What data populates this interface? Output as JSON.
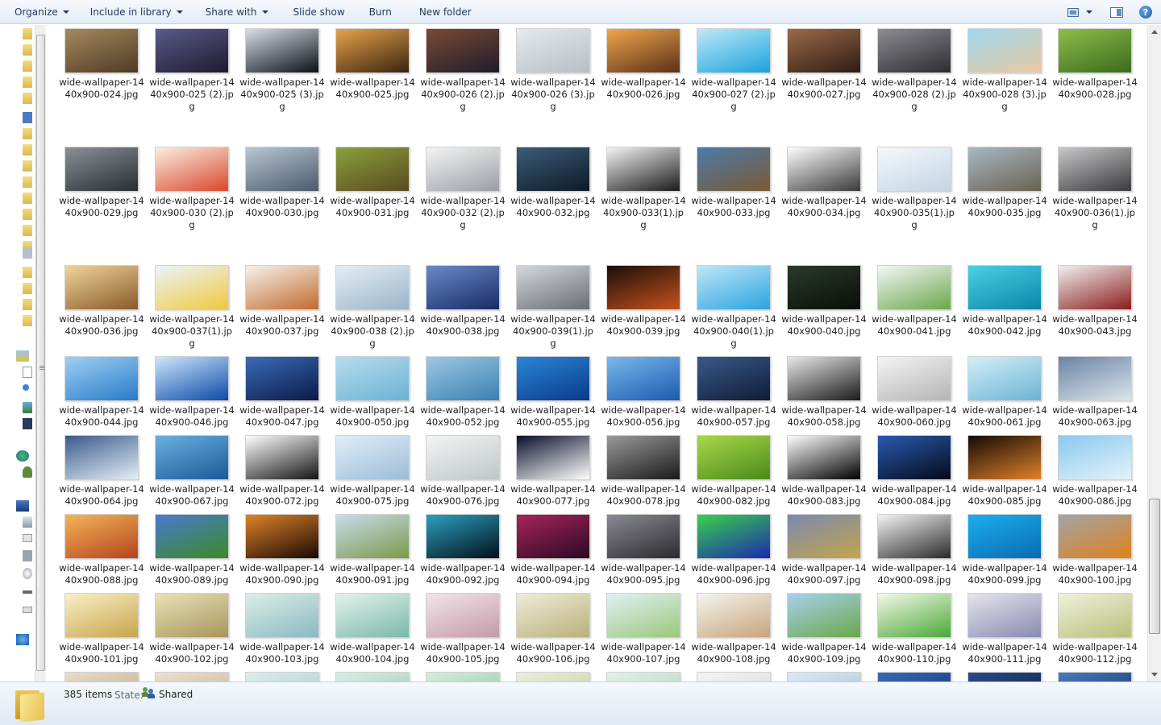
{
  "toolbar": {
    "organize": "Organize",
    "include_in_library": "Include in library",
    "share_with": "Share with",
    "slide_show": "Slide show",
    "burn": "Burn",
    "new_folder": "New folder",
    "help_glyph": "?"
  },
  "files": [
    {
      "name": "wide-wallpaper-1440x900-024.jpg",
      "colors": [
        "#a58a5e",
        "#4f3a24"
      ]
    },
    {
      "name": "wide-wallpaper-1440x900-025 (2).jpg",
      "colors": [
        "#5b5a8a",
        "#1e1a30"
      ]
    },
    {
      "name": "wide-wallpaper-1440x900-025 (3).jpg",
      "colors": [
        "#d9dde6",
        "#0b1018"
      ]
    },
    {
      "name": "wide-wallpaper-1440x900-025.jpg",
      "colors": [
        "#e8a24a",
        "#3a2410"
      ]
    },
    {
      "name": "wide-wallpaper-1440x900-026 (2).jpg",
      "colors": [
        "#7a4a34",
        "#1f1c2c"
      ]
    },
    {
      "name": "wide-wallpaper-1440x900-026 (3).jpg",
      "colors": [
        "#e6e9ec",
        "#b7bec6"
      ]
    },
    {
      "name": "wide-wallpaper-1440x900-026.jpg",
      "colors": [
        "#f0a64e",
        "#5a3016"
      ]
    },
    {
      "name": "wide-wallpaper-1440x900-027 (2).jpg",
      "colors": [
        "#bfe8f8",
        "#1aa3dc"
      ]
    },
    {
      "name": "wide-wallpaper-1440x900-027.jpg",
      "colors": [
        "#9c6a48",
        "#2e1c14"
      ]
    },
    {
      "name": "wide-wallpaper-1440x900-028 (2).jpg",
      "colors": [
        "#8c8c92",
        "#2c2c30"
      ]
    },
    {
      "name": "wide-wallpaper-1440x900-028 (3).jpg",
      "colors": [
        "#9fd8f0",
        "#e8c9a0"
      ]
    },
    {
      "name": "wide-wallpaper-1440x900-028.jpg",
      "colors": [
        "#8cbe4a",
        "#3c6a1c"
      ]
    },
    {
      "name": "wide-wallpaper-1440x900-029.jpg",
      "colors": [
        "#8a9096",
        "#2a2e34"
      ]
    },
    {
      "name": "wide-wallpaper-1440x900-030 (2).jpg",
      "colors": [
        "#fbeee2",
        "#d8482c"
      ]
    },
    {
      "name": "wide-wallpaper-1440x900-030.jpg",
      "colors": [
        "#b9c7d4",
        "#4a5a6c"
      ]
    },
    {
      "name": "wide-wallpaper-1440x900-031.jpg",
      "colors": [
        "#8aa03c",
        "#5a4a20"
      ]
    },
    {
      "name": "wide-wallpaper-1440x900-032 (2).jpg",
      "colors": [
        "#f4f4f4",
        "#9a9ea4"
      ]
    },
    {
      "name": "wide-wallpaper-1440x900-032.jpg",
      "colors": [
        "#3c5c78",
        "#0c1a28"
      ]
    },
    {
      "name": "wide-wallpaper-1440x900-033(1).jpg",
      "colors": [
        "#f4f4f4",
        "#1a1a1a"
      ]
    },
    {
      "name": "wide-wallpaper-1440x900-033.jpg",
      "colors": [
        "#4c7aa8",
        "#7a5a34"
      ]
    },
    {
      "name": "wide-wallpaper-1440x900-034.jpg",
      "colors": [
        "#ffffff",
        "#3a3a3a"
      ]
    },
    {
      "name": "wide-wallpaper-1440x900-035(1).jpg",
      "colors": [
        "#f4f8fc",
        "#c4d4e4"
      ]
    },
    {
      "name": "wide-wallpaper-1440x900-035.jpg",
      "colors": [
        "#a8b8c4",
        "#6a6250"
      ]
    },
    {
      "name": "wide-wallpaper-1440x900-036(1).jpg",
      "colors": [
        "#c8c8cc",
        "#3a3a3e"
      ]
    },
    {
      "name": "wide-wallpaper-1440x900-036.jpg",
      "colors": [
        "#efd49a",
        "#8a5a2a"
      ]
    },
    {
      "name": "wide-wallpaper-1440x900-037(1).jpg",
      "colors": [
        "#eaf4fc",
        "#f0c83c"
      ]
    },
    {
      "name": "wide-wallpaper-1440x900-037.jpg",
      "colors": [
        "#f4f2ee",
        "#c46a2c"
      ]
    },
    {
      "name": "wide-wallpaper-1440x900-038 (2).jpg",
      "colors": [
        "#e4eef6",
        "#9ab4c8"
      ]
    },
    {
      "name": "wide-wallpaper-1440x900-038.jpg",
      "colors": [
        "#6a8ac8",
        "#1a2a68"
      ]
    },
    {
      "name": "wide-wallpaper-1440x900-039(1).jpg",
      "colors": [
        "#d4d8dc",
        "#6a6e72"
      ]
    },
    {
      "name": "wide-wallpaper-1440x900-039.jpg",
      "colors": [
        "#1a0e0a",
        "#c8521c"
      ]
    },
    {
      "name": "wide-wallpaper-1440x900-040(1).jpg",
      "colors": [
        "#bfe6f8",
        "#2aa4e0"
      ]
    },
    {
      "name": "wide-wallpaper-1440x900-040.jpg",
      "colors": [
        "#2a3a2a",
        "#0a0e0a"
      ]
    },
    {
      "name": "wide-wallpaper-1440x900-041.jpg",
      "colors": [
        "#f4f6f8",
        "#6aa84a"
      ]
    },
    {
      "name": "wide-wallpaper-1440x900-042.jpg",
      "colors": [
        "#4ad0e4",
        "#0a86a8"
      ]
    },
    {
      "name": "wide-wallpaper-1440x900-043.jpg",
      "colors": [
        "#f0f0f0",
        "#8a1c1c"
      ]
    },
    {
      "name": "wide-wallpaper-1440x900-044.jpg",
      "colors": [
        "#9ed0f4",
        "#2a7ac8"
      ]
    },
    {
      "name": "wide-wallpaper-1440x900-046.jpg",
      "colors": [
        "#cfe6fa",
        "#0a4aa8"
      ]
    },
    {
      "name": "wide-wallpaper-1440x900-047.jpg",
      "colors": [
        "#3a6cb8",
        "#0a1a48"
      ]
    },
    {
      "name": "wide-wallpaper-1440x900-050.jpg",
      "colors": [
        "#b8dcef",
        "#6ab2d4"
      ]
    },
    {
      "name": "wide-wallpaper-1440x900-052.jpg",
      "colors": [
        "#9cc8e4",
        "#3a80b0"
      ]
    },
    {
      "name": "wide-wallpaper-1440x900-055.jpg",
      "colors": [
        "#2a86d8",
        "#0a3a88"
      ]
    },
    {
      "name": "wide-wallpaper-1440x900-056.jpg",
      "colors": [
        "#7ab8ec",
        "#1a5ab0"
      ]
    },
    {
      "name": "wide-wallpaper-1440x900-057.jpg",
      "colors": [
        "#3a5a88",
        "#0e1c38"
      ]
    },
    {
      "name": "wide-wallpaper-1440x900-058.jpg",
      "colors": [
        "#e8e8e8",
        "#1a1a1a"
      ]
    },
    {
      "name": "wide-wallpaper-1440x900-060.jpg",
      "colors": [
        "#f4f4f4",
        "#b4b4b4"
      ]
    },
    {
      "name": "wide-wallpaper-1440x900-061.jpg",
      "colors": [
        "#d4eef8",
        "#6ab4d4"
      ]
    },
    {
      "name": "wide-wallpaper-1440x900-063.jpg",
      "colors": [
        "#6a84a4",
        "#dce4ec"
      ]
    },
    {
      "name": "wide-wallpaper-1440x900-064.jpg",
      "colors": [
        "#3a5a8a",
        "#e4eef6"
      ]
    },
    {
      "name": "wide-wallpaper-1440x900-067.jpg",
      "colors": [
        "#6ab0e0",
        "#1a5a98"
      ]
    },
    {
      "name": "wide-wallpaper-1440x900-072.jpg",
      "colors": [
        "#ffffff",
        "#141414"
      ]
    },
    {
      "name": "wide-wallpaper-1440x900-075.jpg",
      "colors": [
        "#e0eef8",
        "#9cbcd8"
      ]
    },
    {
      "name": "wide-wallpaper-1440x900-076.jpg",
      "colors": [
        "#f2f4f4",
        "#c0c6c8"
      ]
    },
    {
      "name": "wide-wallpaper-1440x900-077.jpg",
      "colors": [
        "#0a0e2a",
        "#ffffff"
      ]
    },
    {
      "name": "wide-wallpaper-1440x900-078.jpg",
      "colors": [
        "#9a9a9a",
        "#1a1a1a"
      ]
    },
    {
      "name": "wide-wallpaper-1440x900-082.jpg",
      "colors": [
        "#a8d84a",
        "#4a8a1a"
      ]
    },
    {
      "name": "wide-wallpaper-1440x900-083.jpg",
      "colors": [
        "#ffffff",
        "#000000"
      ]
    },
    {
      "name": "wide-wallpaper-1440x900-084.jpg",
      "colors": [
        "#2a5ab0",
        "#040a1a"
      ]
    },
    {
      "name": "wide-wallpaper-1440x900-085.jpg",
      "colors": [
        "#140a04",
        "#e0822a"
      ]
    },
    {
      "name": "wide-wallpaper-1440x900-086.jpg",
      "colors": [
        "#8ac8f0",
        "#e4f2fa"
      ]
    },
    {
      "name": "wide-wallpaper-1440x900-088.jpg",
      "colors": [
        "#f4b45a",
        "#b4441c"
      ]
    },
    {
      "name": "wide-wallpaper-1440x900-089.jpg",
      "colors": [
        "#4a7ad0",
        "#3a8a24"
      ]
    },
    {
      "name": "wide-wallpaper-1440x900-090.jpg",
      "colors": [
        "#e0822a",
        "#1a0a04"
      ]
    },
    {
      "name": "wide-wallpaper-1440x900-091.jpg",
      "colors": [
        "#c8dcea",
        "#7a9a4a"
      ]
    },
    {
      "name": "wide-wallpaper-1440x900-092.jpg",
      "colors": [
        "#2aa0c0",
        "#04101a"
      ]
    },
    {
      "name": "wide-wallpaper-1440x900-094.jpg",
      "colors": [
        "#a8245a",
        "#2a0a24"
      ]
    },
    {
      "name": "wide-wallpaper-1440x900-095.jpg",
      "colors": [
        "#8a8a92",
        "#2a2a2e"
      ]
    },
    {
      "name": "wide-wallpaper-1440x900-096.jpg",
      "colors": [
        "#3ad04a",
        "#1a2ab0"
      ]
    },
    {
      "name": "wide-wallpaper-1440x900-097.jpg",
      "colors": [
        "#7a8ab0",
        "#c4a44a"
      ]
    },
    {
      "name": "wide-wallpaper-1440x900-098.jpg",
      "colors": [
        "#f4f4f4",
        "#2a2a2a"
      ]
    },
    {
      "name": "wide-wallpaper-1440x900-099.jpg",
      "colors": [
        "#1ab0ee",
        "#0a6ab0"
      ]
    },
    {
      "name": "wide-wallpaper-1440x900-100.jpg",
      "colors": [
        "#a0a4a8",
        "#e0821a"
      ]
    },
    {
      "name": "wide-wallpaper-1440x900-101.jpg",
      "colors": [
        "#f8f0c8",
        "#c8a44a"
      ]
    },
    {
      "name": "wide-wallpaper-1440x900-102.jpg",
      "colors": [
        "#e8e2b8",
        "#a8945a"
      ]
    },
    {
      "name": "wide-wallpaper-1440x900-103.jpg",
      "colors": [
        "#dceee8",
        "#8ab8c0"
      ]
    },
    {
      "name": "wide-wallpaper-1440x900-104.jpg",
      "colors": [
        "#e4f2ec",
        "#7ab8a8"
      ]
    },
    {
      "name": "wide-wallpaper-1440x900-105.jpg",
      "colors": [
        "#f2e4e8",
        "#c49aa8"
      ]
    },
    {
      "name": "wide-wallpaper-1440x900-106.jpg",
      "colors": [
        "#f0ecd8",
        "#b8b07a"
      ]
    },
    {
      "name": "wide-wallpaper-1440x900-107.jpg",
      "colors": [
        "#e0f0f4",
        "#9ac87a"
      ]
    },
    {
      "name": "wide-wallpaper-1440x900-108.jpg",
      "colors": [
        "#f4f4f0",
        "#c8a47a"
      ]
    },
    {
      "name": "wide-wallpaper-1440x900-109.jpg",
      "colors": [
        "#a8d0ec",
        "#6aa84a"
      ]
    },
    {
      "name": "wide-wallpaper-1440x900-110.jpg",
      "colors": [
        "#f4f8e8",
        "#4aa83a"
      ]
    },
    {
      "name": "wide-wallpaper-1440x900-111.jpg",
      "colors": [
        "#e4e4ee",
        "#8a8ab0"
      ]
    },
    {
      "name": "wide-wallpaper-1440x900-112.jpg",
      "colors": [
        "#f0f0dc",
        "#b8c07a"
      ]
    }
  ],
  "partial_row_colors": [
    [
      "#e8dcc8",
      "#b8a488"
    ],
    [
      "#ece0d0",
      "#c4ae90"
    ],
    [
      "#dcecec",
      "#a8c8c8"
    ],
    [
      "#d8eee4",
      "#98c4b0"
    ],
    [
      "#d4ecdc",
      "#8ac49a"
    ],
    [
      "#eaeedc",
      "#c4c89a"
    ],
    [
      "#e4f0e8",
      "#a8d0b8"
    ],
    [
      "#f4f4f4",
      "#d4d4d4"
    ],
    [
      "#dce8f4",
      "#a4bcd4"
    ],
    [
      "#3a6ab8",
      "#0a2a68"
    ],
    [
      "#2a4a88",
      "#0a1a38"
    ],
    [
      "#4a7ac0",
      "#0a2a58"
    ]
  ],
  "details": {
    "item_count": "385 items",
    "state_label": "State:",
    "state_value": "Shared"
  }
}
